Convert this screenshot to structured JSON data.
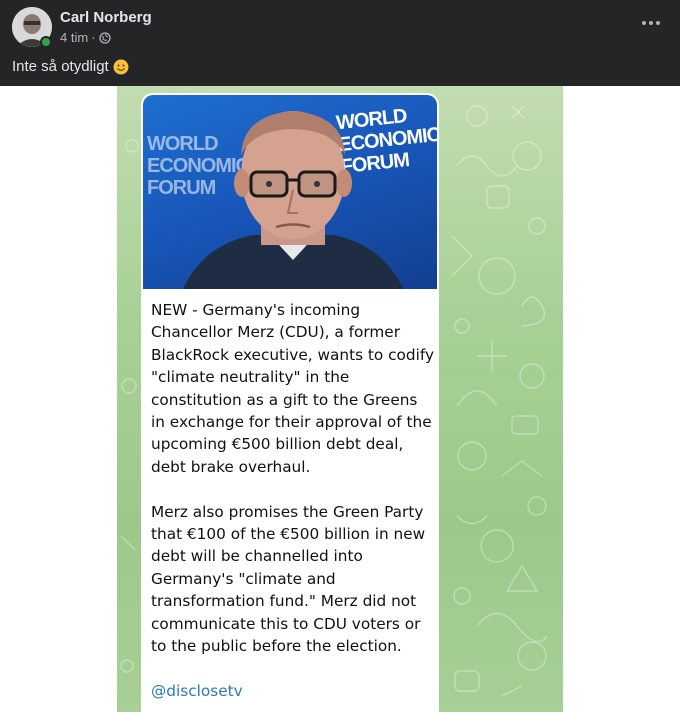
{
  "post": {
    "author": "Carl Norberg",
    "time": "4 tim",
    "separator": "·",
    "text": "Inte så otydligt",
    "colors": {
      "online": "#31a24c",
      "header_bg": "#242526"
    }
  },
  "image": {
    "photo_logo_left": [
      "WORLD",
      "ECONOMIC",
      "FORUM"
    ],
    "photo_logo_right": [
      "WORLD",
      "ECONOMIC",
      "FORUM"
    ],
    "paragraph1": "NEW - Germany's incoming Chancellor Merz (CDU), a former BlackRock executive, wants to codify \"climate neutrality\" in the constitution as a gift to the Greens in exchange for their approval of the upcoming €500 billion debt deal, debt brake overhaul.",
    "paragraph2": "Merz also promises the Green Party that €100 of the €500 billion in new debt will be channelled into Germany's \"climate and transformation fund.\" Merz did not communicate this to CDU voters or to the public before the election.",
    "handle": "@disclosetv"
  }
}
